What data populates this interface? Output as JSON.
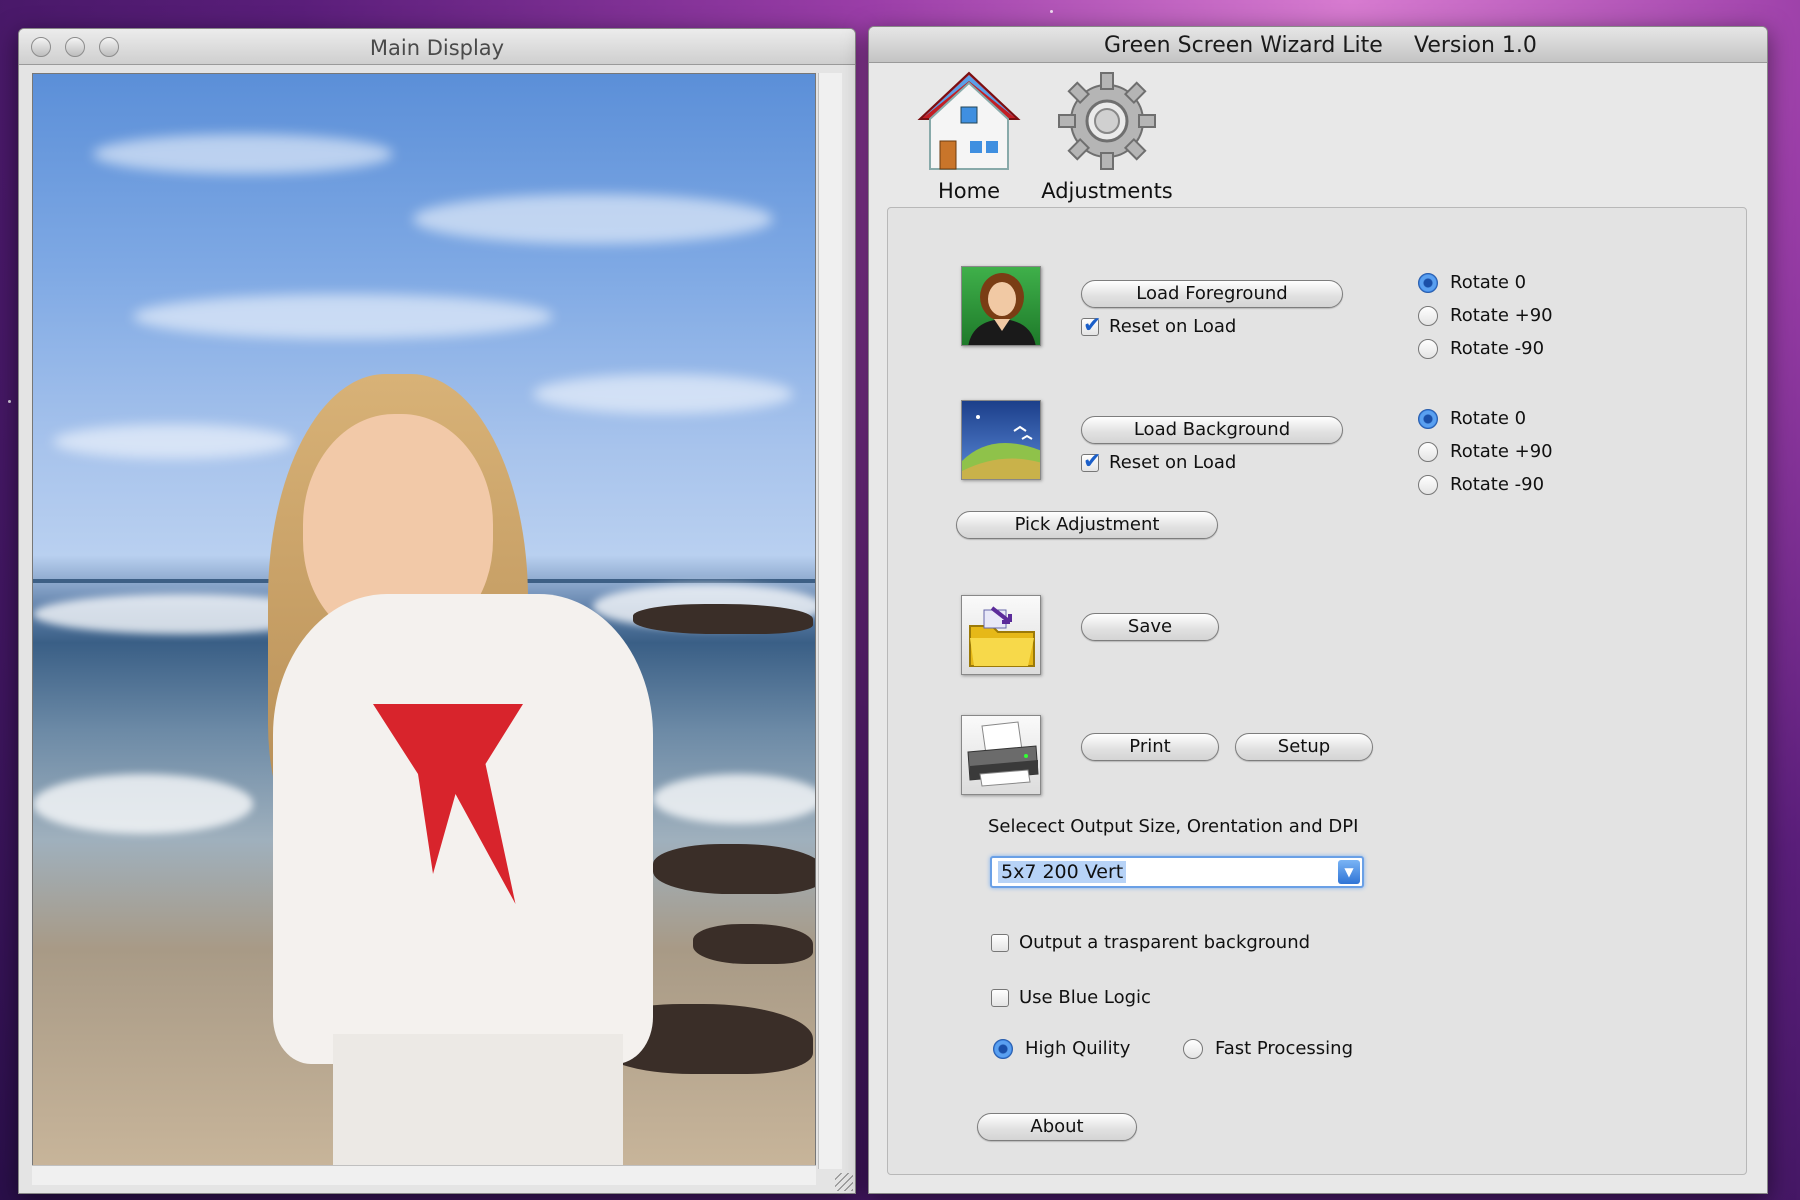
{
  "main_display": {
    "title": "Main Display"
  },
  "app": {
    "title": "Green Screen Wizard Lite",
    "version": "Version 1.0",
    "toolbar": {
      "home_label": "Home",
      "adjustments_label": "Adjustments"
    }
  },
  "foreground": {
    "load_label": "Load Foreground",
    "reset_label": "Reset on Load",
    "reset_checked": true,
    "rotate_options": [
      "Rotate 0",
      "Rotate +90",
      "Rotate -90"
    ],
    "rotate_selected": "Rotate 0"
  },
  "background": {
    "load_label": "Load Background",
    "reset_label": "Reset on Load",
    "reset_checked": true,
    "rotate_options": [
      "Rotate 0",
      "Rotate +90",
      "Rotate -90"
    ],
    "rotate_selected": "Rotate 0"
  },
  "pick_adjustment_label": "Pick Adjustment",
  "save_label": "Save",
  "print_label": "Print",
  "setup_label": "Setup",
  "output": {
    "caption": "Selecect Output Size, Orentation and DPI",
    "selected_value": "5x7 200 Vert"
  },
  "options": {
    "transparent_label": "Output a trasparent background",
    "transparent_checked": false,
    "blue_logic_label": "Use Blue Logic",
    "blue_logic_checked": false,
    "quality_options": [
      "High Quility",
      "Fast Processing"
    ],
    "quality_selected": "High Quility"
  },
  "about_label": "About",
  "colors": {
    "accent_blue": "#2d72d6",
    "button_border": "#7d7d7d"
  }
}
